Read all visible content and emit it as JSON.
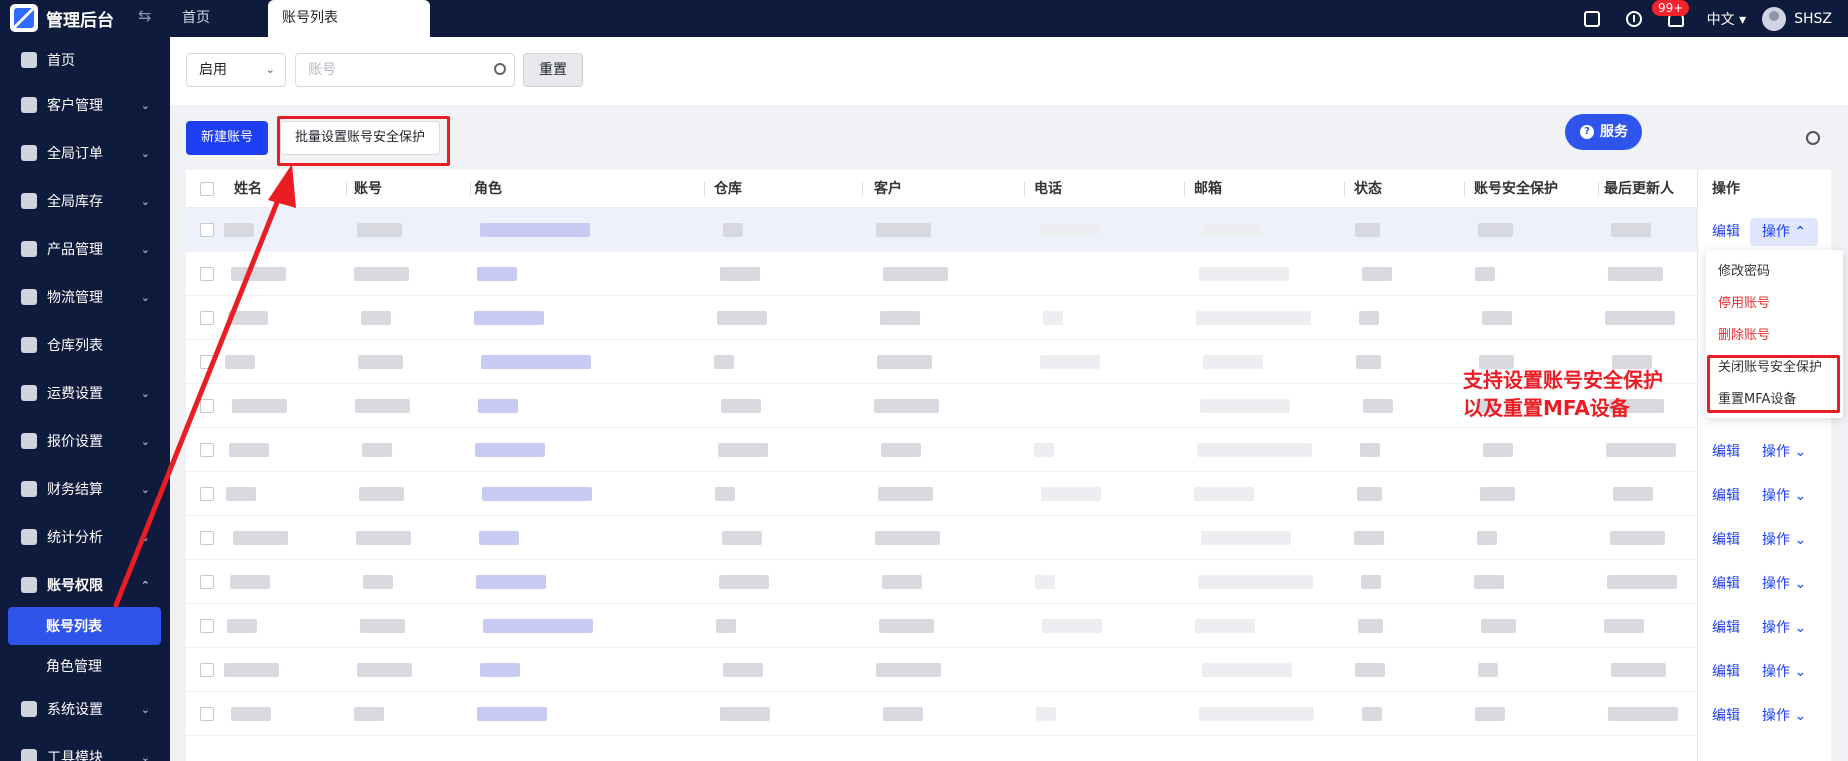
{
  "header": {
    "brand": "管理后台",
    "tabs": [
      {
        "label": "首页"
      },
      {
        "label": "账号列表"
      }
    ],
    "notification_count": "99+",
    "language": "中文",
    "username": "SHSZ"
  },
  "sidebar": {
    "items": [
      {
        "label": "首页",
        "icon": "home-icon"
      },
      {
        "label": "客户管理",
        "icon": "users-icon"
      },
      {
        "label": "全局订单",
        "icon": "order-icon"
      },
      {
        "label": "全局库存",
        "icon": "inventory-icon"
      },
      {
        "label": "产品管理",
        "icon": "product-icon"
      },
      {
        "label": "物流管理",
        "icon": "truck-icon"
      },
      {
        "label": "仓库列表",
        "icon": "warehouse-icon"
      },
      {
        "label": "运费设置",
        "icon": "shipping-icon"
      },
      {
        "label": "报价设置",
        "icon": "quote-icon"
      },
      {
        "label": "财务结算",
        "icon": "finance-icon"
      },
      {
        "label": "统计分析",
        "icon": "stats-icon"
      },
      {
        "label": "账号权限",
        "icon": "permission-icon"
      },
      {
        "label": "账号列表",
        "icon": ""
      },
      {
        "label": "角色管理",
        "icon": ""
      },
      {
        "label": "系统设置",
        "icon": "settings-icon"
      },
      {
        "label": "工具模块",
        "icon": "tools-icon"
      }
    ]
  },
  "filters": {
    "status_value": "启用",
    "account_placeholder": "账号",
    "reset_label": "重置"
  },
  "toolbar": {
    "new_account_label": "新建账号",
    "batch_label": "批量设置账号安全保护",
    "service_label": "服务"
  },
  "table": {
    "columns": [
      "姓名",
      "账号",
      "角色",
      "仓库",
      "客户",
      "电话",
      "邮箱",
      "状态",
      "账号安全保护",
      "最后更新人",
      "操作"
    ],
    "row_action_edit": "编辑",
    "row_action_more": "操作"
  },
  "dropdown": {
    "items": [
      "修改密码",
      "停用账号",
      "删除账号",
      "关闭账号安全保护",
      "重置MFA设备"
    ]
  },
  "annotation": {
    "line1": "支持设置账号安全保护",
    "line2": "以及重置MFA设备",
    "color": "#ea1c24"
  }
}
